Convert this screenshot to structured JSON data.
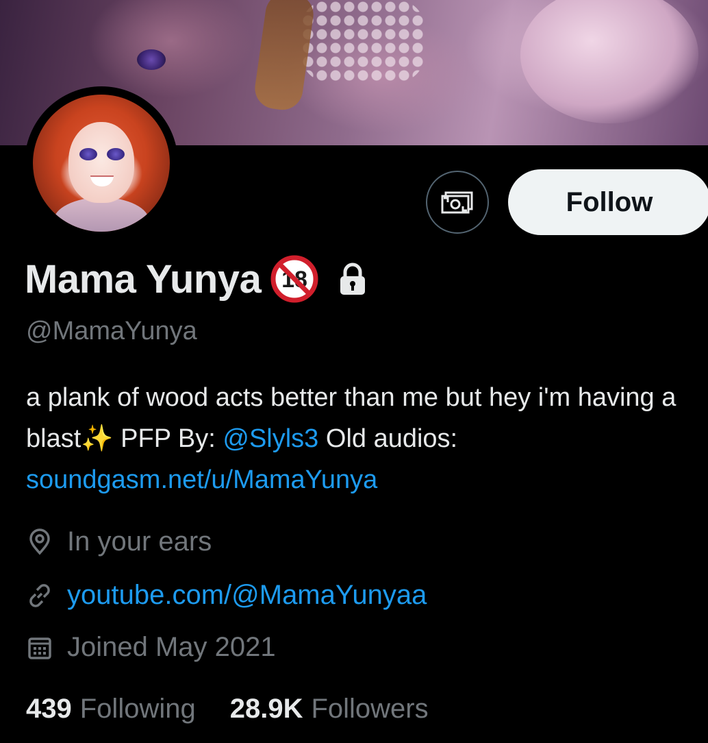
{
  "profile": {
    "display_name": "Mama Yunya",
    "handle": "@MamaYunya",
    "bio_part1": "a plank of wood acts better than me but hey i'm having a blast✨ PFP By: ",
    "bio_mention": "@Slyls3",
    "bio_part2": " Old audios: ",
    "bio_link": "soundgasm.net/u/MamaYunya",
    "location": "In your ears",
    "website": "youtube.com/@MamaYunyaa",
    "joined": "Joined May 2021"
  },
  "actions": {
    "follow_label": "Follow",
    "tip_icon": "money-icon"
  },
  "badges": {
    "age_badge_text": "18",
    "age_badge_icon": "no-one-under-18-icon",
    "protected_icon": "lock-icon"
  },
  "stats": {
    "following_count": "439",
    "following_label": "Following",
    "followers_count": "28.9K",
    "followers_label": "Followers"
  },
  "colors": {
    "background": "#000000",
    "primary_text": "#e7e9ea",
    "secondary_text": "#71767b",
    "link": "#1d9bf0",
    "follow_button_bg": "#eff3f4",
    "badge_red": "#d11f2c"
  }
}
